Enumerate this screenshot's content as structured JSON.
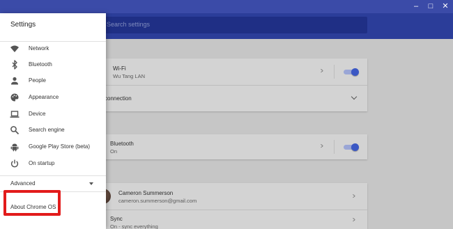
{
  "window": {
    "controls": [
      "–",
      "□",
      "✕"
    ]
  },
  "search": {
    "placeholder": "Search settings"
  },
  "drawer": {
    "title": "Settings",
    "items": [
      {
        "label": "Network",
        "icon": "wifi-icon"
      },
      {
        "label": "Bluetooth",
        "icon": "bluetooth-icon"
      },
      {
        "label": "People",
        "icon": "person-icon"
      },
      {
        "label": "Appearance",
        "icon": "palette-icon"
      },
      {
        "label": "Device",
        "icon": "laptop-icon"
      },
      {
        "label": "Search engine",
        "icon": "search-icon"
      },
      {
        "label": "Google Play Store (beta)",
        "icon": "android-icon"
      },
      {
        "label": "On startup",
        "icon": "power-icon"
      }
    ],
    "advanced": "Advanced",
    "about": "About Chrome OS"
  },
  "main": {
    "network_label": "k",
    "wifi": {
      "title": "Wi-Fi",
      "network": "Wu Tang LAN"
    },
    "add_connection": "connection",
    "bluetooth_label": "h",
    "bluetooth": {
      "title": "Bluetooth",
      "status": "On"
    },
    "people": {
      "name": "Cameron Summerson",
      "email": "cameron.summerson@gmail.com"
    },
    "sync": {
      "title": "Sync",
      "status": "On - sync everything"
    }
  },
  "colors": {
    "header": "#2b3d99",
    "window_bar": "#3b4ba8",
    "highlight": "#e21b1b",
    "toggle_on": "#3b58c4"
  }
}
